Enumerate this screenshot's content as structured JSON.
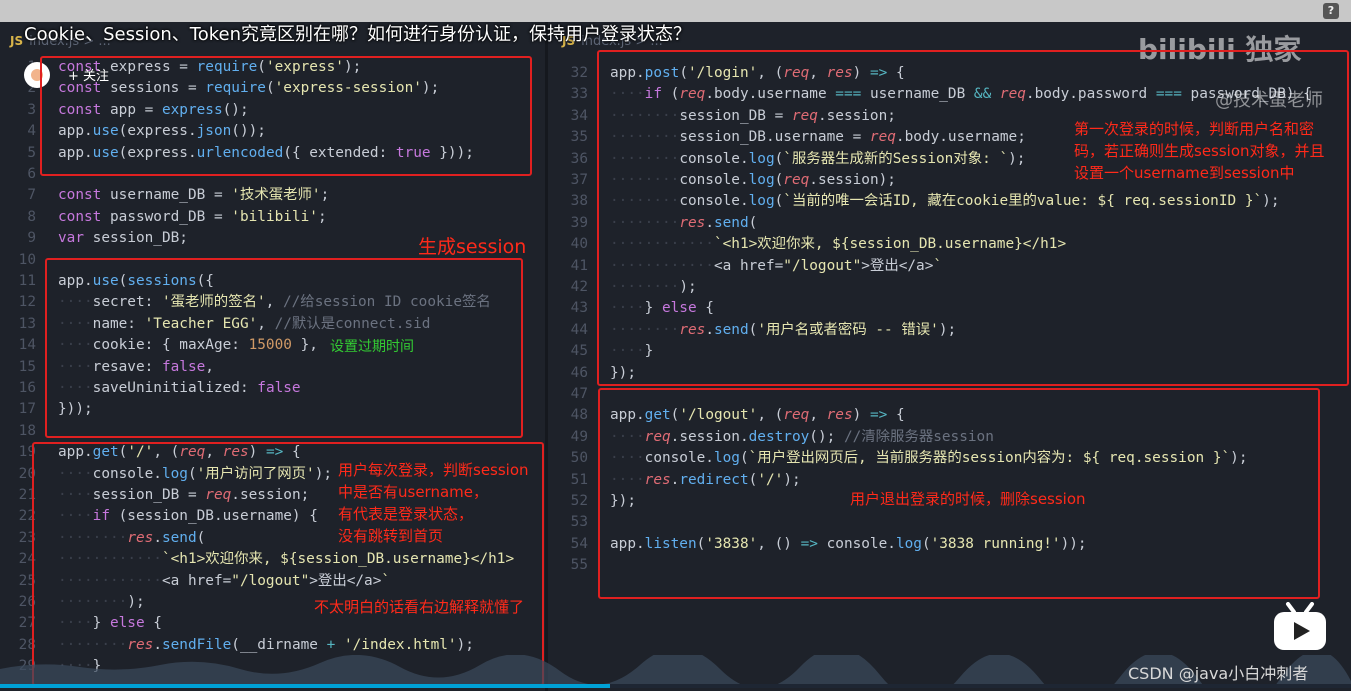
{
  "video_title": "Cookie、Session、Token究竟区别在哪？如何进行身份认证，保持用户登录状态？",
  "follow_label": "+ 关注",
  "watermark_brand": "bilibili 独家",
  "watermark_author": "@技术蛋老师",
  "csdn_watermark": "CSDN @java小白冲刺者",
  "tabs": {
    "left": "index.js > ...",
    "right": "index.js > ..."
  },
  "tab_badge": "JS",
  "annotations": {
    "gen_session": "生成session",
    "expire": "设置过期时间",
    "each_login_1": "用户每次登录，判断session",
    "each_login_2": "中是否有username，",
    "each_login_3": "有代表是登录状态，",
    "each_login_4": "没有跳转到首页",
    "see_right": "不太明白的话看右边解释就懂了",
    "first_login_1": "第一次登录的时候，判断用户名和密",
    "first_login_2": "码，若正确则生成session对象，并且",
    "first_login_3": "设置一个username到session中",
    "logout": "用户退出登录的时候，删除session"
  },
  "left_lines": [
    {
      "n": "1",
      "code": "const express = require('express');"
    },
    {
      "n": "2",
      "code": "const sessions = require('express-session');"
    },
    {
      "n": "3",
      "code": "const app = express();"
    },
    {
      "n": "4",
      "code": "app.use(express.json());"
    },
    {
      "n": "5",
      "code": "app.use(express.urlencoded({ extended: true }));"
    },
    {
      "n": "6",
      "code": ""
    },
    {
      "n": "7",
      "code": "const username_DB = '技术蛋老师';"
    },
    {
      "n": "8",
      "code": "const password_DB = 'bilibili';"
    },
    {
      "n": "9",
      "code": "var session_DB;"
    },
    {
      "n": "10",
      "code": ""
    },
    {
      "n": "11",
      "code": "app.use(sessions({"
    },
    {
      "n": "12",
      "code": "    secret: '蛋老师的签名', //给session ID cookie签名"
    },
    {
      "n": "13",
      "code": "    name: 'Teacher EGG', //默认是connect.sid"
    },
    {
      "n": "14",
      "code": "    cookie: { maxAge: 15000 },"
    },
    {
      "n": "15",
      "code": "    resave: false,"
    },
    {
      "n": "16",
      "code": "    saveUninitialized: false"
    },
    {
      "n": "17",
      "code": "}));"
    },
    {
      "n": "18",
      "code": ""
    },
    {
      "n": "19",
      "code": "app.get('/', (req, res) => {"
    },
    {
      "n": "20",
      "code": "    console.log('用户访问了网页');"
    },
    {
      "n": "21",
      "code": "    session_DB = req.session;"
    },
    {
      "n": "22",
      "code": "    if (session_DB.username) {"
    },
    {
      "n": "23",
      "code": "        res.send("
    },
    {
      "n": "24",
      "code": "            `<h1>欢迎你来, ${session_DB.username}</h1>"
    },
    {
      "n": "25",
      "code": "            <a href=\"/logout\">登出</a>`"
    },
    {
      "n": "26",
      "code": "        );"
    },
    {
      "n": "27",
      "code": "    } else {"
    },
    {
      "n": "28",
      "code": "        res.sendFile(__dirname + '/index.html');"
    },
    {
      "n": "29",
      "code": "    }"
    }
  ],
  "right_lines": [
    {
      "n": "32",
      "code": "app.post('/login', (req, res) => {"
    },
    {
      "n": "33",
      "code": "    if (req.body.username === username_DB && req.body.password === password_DB) {"
    },
    {
      "n": "34",
      "code": "        session_DB = req.session;"
    },
    {
      "n": "35",
      "code": "        session_DB.username = req.body.username;"
    },
    {
      "n": "36",
      "code": "        console.log(`服务器生成新的Session对象: `);"
    },
    {
      "n": "37",
      "code": "        console.log(req.session);"
    },
    {
      "n": "38",
      "code": "        console.log(`当前的唯一会话ID, 藏在cookie里的value: ${ req.sessionID }`);"
    },
    {
      "n": "39",
      "code": "        res.send("
    },
    {
      "n": "40",
      "code": "            `<h1>欢迎你来, ${session_DB.username}</h1>"
    },
    {
      "n": "41",
      "code": "            <a href=\"/logout\">登出</a>`"
    },
    {
      "n": "42",
      "code": "        );"
    },
    {
      "n": "43",
      "code": "    } else {"
    },
    {
      "n": "44",
      "code": "        res.send('用户名或者密码 -- 错误');"
    },
    {
      "n": "45",
      "code": "    }"
    },
    {
      "n": "46",
      "code": "});"
    },
    {
      "n": "47",
      "code": ""
    },
    {
      "n": "48",
      "code": "app.get('/logout', (req, res) => {"
    },
    {
      "n": "49",
      "code": "    req.session.destroy(); //清除服务器session"
    },
    {
      "n": "50",
      "code": "    console.log(`用户登出网页后, 当前服务器的session内容为: ${ req.session }`);"
    },
    {
      "n": "51",
      "code": "    res.redirect('/');"
    },
    {
      "n": "52",
      "code": "});"
    },
    {
      "n": "53",
      "code": ""
    },
    {
      "n": "54",
      "code": "app.listen('3838', () => console.log('3838 running!'));"
    },
    {
      "n": "55",
      "code": ""
    }
  ],
  "colors": {
    "highlight_box": "#e02020",
    "annotation": "#ff2a1a",
    "annotation_green": "#33cc33",
    "progress": "#00a1d6"
  }
}
